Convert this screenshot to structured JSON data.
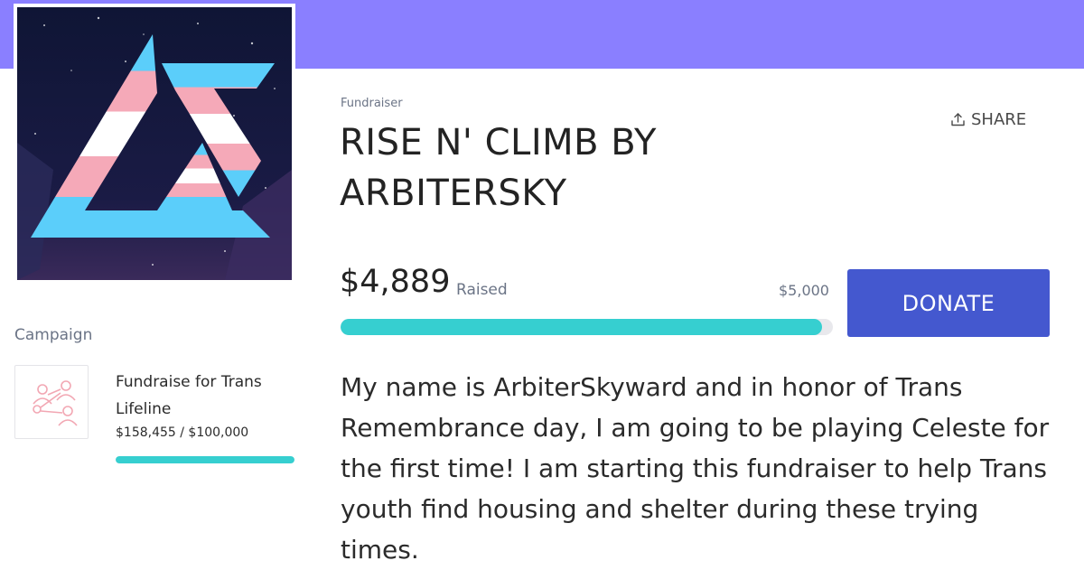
{
  "fundraiser": {
    "type_label": "Fundraiser",
    "title": "RISE N' CLIMB BY ARBITERSKY",
    "share_label": "SHARE",
    "raised_amount": "$4,889",
    "raised_label": "Raised",
    "goal_amount": "$5,000",
    "progress_fraction": 0.978,
    "donate_label": "DONATE",
    "description": "My name is ArbiterSkyward and in honor of Trans Remembrance day, I am going to be playing Celeste for the first time! I am starting this fundraiser to help Trans youth find housing and shelter during these trying times."
  },
  "campaign": {
    "section_label": "Campaign",
    "title": "Fundraise for Trans Lifeline",
    "amount": "$158,455 / $100,000",
    "progress_fraction": 1.0
  },
  "colors": {
    "banner": "#8a7fff",
    "accent_teal": "#36cfd0",
    "donate_blue": "#4458cf",
    "trans_blue": "#5bcefa",
    "trans_pink": "#f5a9b8"
  },
  "icons": {
    "share": "share-upload-icon",
    "campaign_thumb": "people-network-icon"
  }
}
